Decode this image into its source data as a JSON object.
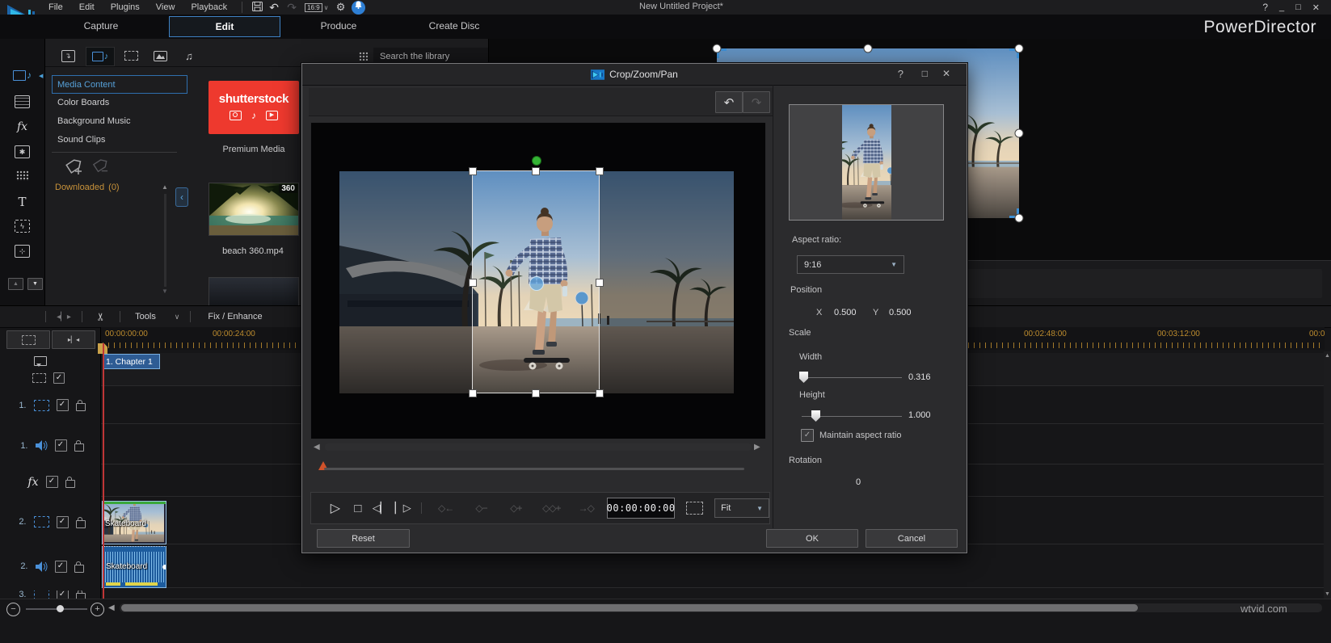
{
  "app": {
    "title": "PowerDirector",
    "project_title": "New Untitled Project*",
    "aspect_label": "16:9"
  },
  "menu": {
    "items": [
      "File",
      "Edit",
      "Plugins",
      "View",
      "Playback"
    ]
  },
  "tabs": [
    {
      "label": "Capture"
    },
    {
      "label": "Edit"
    },
    {
      "label": "Produce"
    },
    {
      "label": "Create Disc"
    }
  ],
  "library": {
    "search_placeholder": "Search the library",
    "categories": [
      {
        "label": "Media Content"
      },
      {
        "label": "Color Boards"
      },
      {
        "label": "Background Music"
      },
      {
        "label": "Sound Clips"
      }
    ],
    "downloaded_label": "Downloaded",
    "downloaded_count": "(0)",
    "shutterstock_label": "shutterstock",
    "premium_label": "Premium Media",
    "items": [
      {
        "name": "beach 360.mp4",
        "badge": "360"
      }
    ]
  },
  "dialog": {
    "title": "Crop/Zoom/Pan",
    "aspect_ratio_label": "Aspect ratio:",
    "aspect_ratio_value": "9:16",
    "position_label": "Position",
    "x_label": "X",
    "x_value": "0.500",
    "y_label": "Y",
    "y_value": "0.500",
    "scale_label": "Scale",
    "width_label": "Width",
    "width_value": "0.316",
    "height_label": "Height",
    "height_value": "1.000",
    "maintain_label": "Maintain aspect ratio",
    "rotation_label": "Rotation",
    "rotation_value": "0",
    "timecode": "00:00:00:00",
    "fit_label": "Fit",
    "reset_label": "Reset",
    "ok_label": "OK",
    "cancel_label": "Cancel"
  },
  "timeline": {
    "tools_label": "Tools",
    "fix_enhance_label": "Fix / Enhance",
    "ruler_left": [
      "00:00:00:00",
      "00:00:24:00"
    ],
    "ruler_right": [
      "00:02:48:00",
      "00:03:12:00",
      "00:0"
    ],
    "chapter_marker": "1. Chapter 1",
    "tracks": [
      {
        "label": "",
        "type": "chapter"
      },
      {
        "label": "",
        "type": "marker"
      },
      {
        "label": "1.",
        "type": "video"
      },
      {
        "label": "1.",
        "type": "audio"
      },
      {
        "label": "fx",
        "type": "fx"
      },
      {
        "label": "2.",
        "type": "video"
      },
      {
        "label": "2.",
        "type": "audio"
      },
      {
        "label": "3.",
        "type": "video"
      }
    ],
    "video_clip_name": "Skateboard",
    "audio_clip_name": "Skateboard",
    "watermark": "wtvid.com"
  },
  "icons": {
    "undo": "↶",
    "redo": "↷",
    "gear": "⚙",
    "chevron_down": "∨",
    "dropdown": "▼",
    "play": "▷",
    "stop": "□",
    "step_back": "◁▏",
    "step_fwd": "▏▷",
    "kf_prev": "◇←",
    "kf_remove": "◇−",
    "kf_add": "◇+",
    "kf_add_all": "◇◇+",
    "kf_next": "→◇",
    "left": "◀",
    "right": "▶",
    "up": "▲",
    "down": "▼",
    "minus": "−",
    "plus": "+",
    "check": "✓",
    "collapse": "‹",
    "music_note": "♪",
    "music_notes": "♫",
    "scissors": "✂",
    "split": "◂▏▸",
    "help": "?",
    "minimize": "_",
    "maximize": "□",
    "close": "✕",
    "star": "✱",
    "bolt": "ϟ",
    "fx": "fx",
    "title_t": "T"
  },
  "colors": {
    "accent": "#3d8fd4",
    "selection": "#2f6fae",
    "ruler_orange": "#bd8c2e",
    "shutterstock_red": "#ee392e",
    "playhead_red": "#c03636",
    "keyframe_green": "#35b435",
    "handle_blue": "#5aa0dc"
  }
}
